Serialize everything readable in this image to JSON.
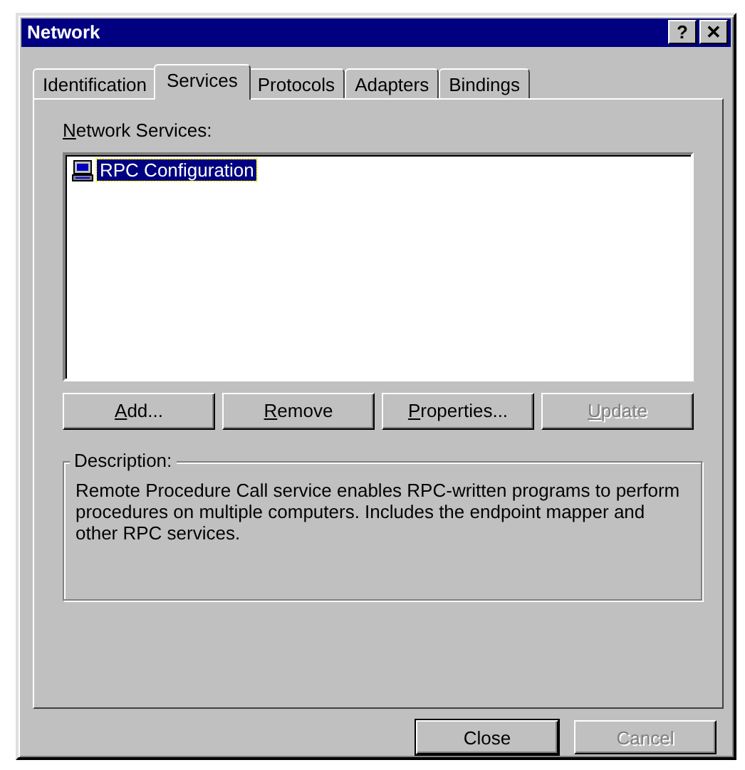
{
  "window": {
    "title": "Network",
    "help_button": "?",
    "close_button": "✕"
  },
  "tabs": [
    {
      "label": "Identification",
      "selected": false
    },
    {
      "label": "Services",
      "selected": true
    },
    {
      "label": "Protocols",
      "selected": false
    },
    {
      "label": "Adapters",
      "selected": false
    },
    {
      "label": "Bindings",
      "selected": false
    }
  ],
  "services": {
    "label": {
      "accel": "N",
      "rest": "etwork Services:"
    },
    "items": [
      {
        "label": "RPC Configuration",
        "selected": true
      }
    ]
  },
  "service_buttons": [
    {
      "accel": "A",
      "rest": "dd...",
      "disabled": false
    },
    {
      "accel": "R",
      "rest": "emove",
      "disabled": false
    },
    {
      "accel": "P",
      "rest": "roperties...",
      "disabled": false
    },
    {
      "accel": "U",
      "rest": "pdate",
      "disabled": true
    }
  ],
  "description": {
    "label": "Description:",
    "text": "Remote Procedure Call service enables RPC-written programs to perform procedures on multiple computers. Includes the endpoint mapper and other RPC services."
  },
  "dialog_buttons": [
    {
      "label": "Close",
      "disabled": false,
      "default": true
    },
    {
      "label": "Cancel",
      "disabled": true,
      "default": false
    }
  ]
}
